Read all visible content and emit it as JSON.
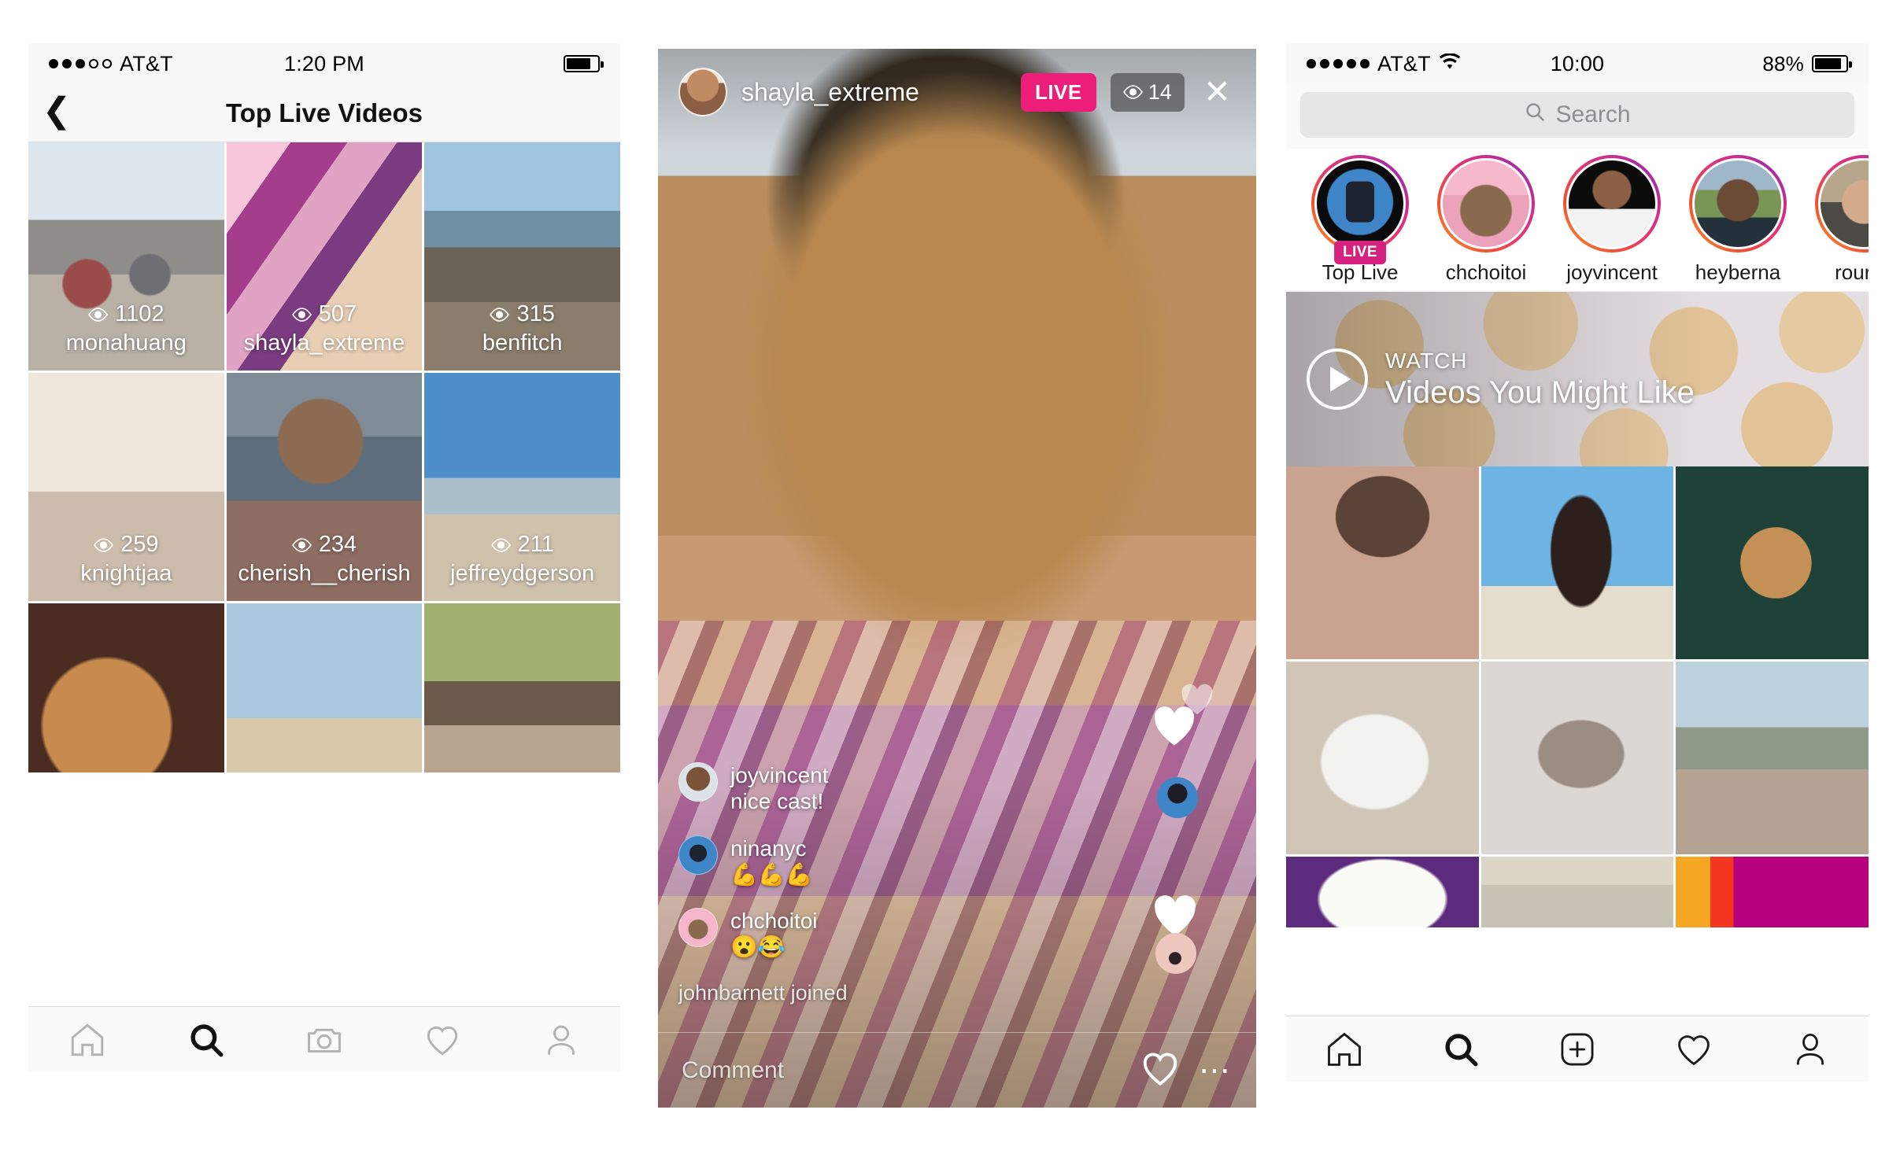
{
  "phone1": {
    "status": {
      "carrier": "AT&T",
      "signal_filled": 3,
      "signal_total": 5,
      "time": "1:20 PM",
      "battery_pct": 80
    },
    "navbar": {
      "back_icon": "chevron-left-icon",
      "title": "Top Live Videos"
    },
    "live_videos": [
      {
        "views": "1102",
        "username": "monahuang"
      },
      {
        "views": "507",
        "username": "shayla_extreme"
      },
      {
        "views": "315",
        "username": "benfitch"
      },
      {
        "views": "259",
        "username": "knightjaa"
      },
      {
        "views": "234",
        "username": "cherish__cherish"
      },
      {
        "views": "211",
        "username": "jeffreydgerson"
      },
      {
        "views": "",
        "username": ""
      },
      {
        "views": "",
        "username": ""
      },
      {
        "views": "",
        "username": ""
      }
    ],
    "tabs": [
      {
        "name": "home-icon",
        "active": false
      },
      {
        "name": "search-icon",
        "active": true
      },
      {
        "name": "camera-icon",
        "active": false
      },
      {
        "name": "heart-icon",
        "active": false
      },
      {
        "name": "profile-icon",
        "active": false
      }
    ]
  },
  "phone2": {
    "header": {
      "username": "shayla_extreme",
      "live_label": "LIVE",
      "viewer_count": "14",
      "close_icon": "close-icon",
      "live_color": "#ed1e79"
    },
    "comments": [
      {
        "username": "joyvincent",
        "text": "nice cast!"
      },
      {
        "username": "ninanyc",
        "text": "💪💪💪"
      },
      {
        "username": "chchoitoi",
        "text": "😮😂"
      }
    ],
    "join_notice": "johnbarnett joined",
    "footer": {
      "comment_placeholder": "Comment",
      "heart_icon": "heart-icon",
      "more_icon": "more-options-icon"
    }
  },
  "phone3": {
    "status": {
      "carrier": "AT&T",
      "signal_filled": 5,
      "signal_total": 5,
      "wifi": "wifi-icon",
      "time": "10:00",
      "battery_text": "88%",
      "battery_pct": 88
    },
    "search": {
      "placeholder": "Search",
      "icon": "search-icon"
    },
    "stories": [
      {
        "label": "Top Live",
        "badge": "LIVE"
      },
      {
        "label": "chchoitoi",
        "badge": ""
      },
      {
        "label": "joyvincent",
        "badge": ""
      },
      {
        "label": "heyberna",
        "badge": ""
      },
      {
        "label": "rourke",
        "badge": ""
      }
    ],
    "watch_banner": {
      "kicker": "WATCH",
      "title": "Videos You Might Like",
      "play_icon": "play-icon"
    },
    "tabs": [
      {
        "name": "home-icon",
        "active": false
      },
      {
        "name": "search-icon",
        "active": true
      },
      {
        "name": "new-post-icon",
        "active": false
      },
      {
        "name": "heart-icon",
        "active": false
      },
      {
        "name": "profile-icon",
        "active": false
      }
    ]
  }
}
